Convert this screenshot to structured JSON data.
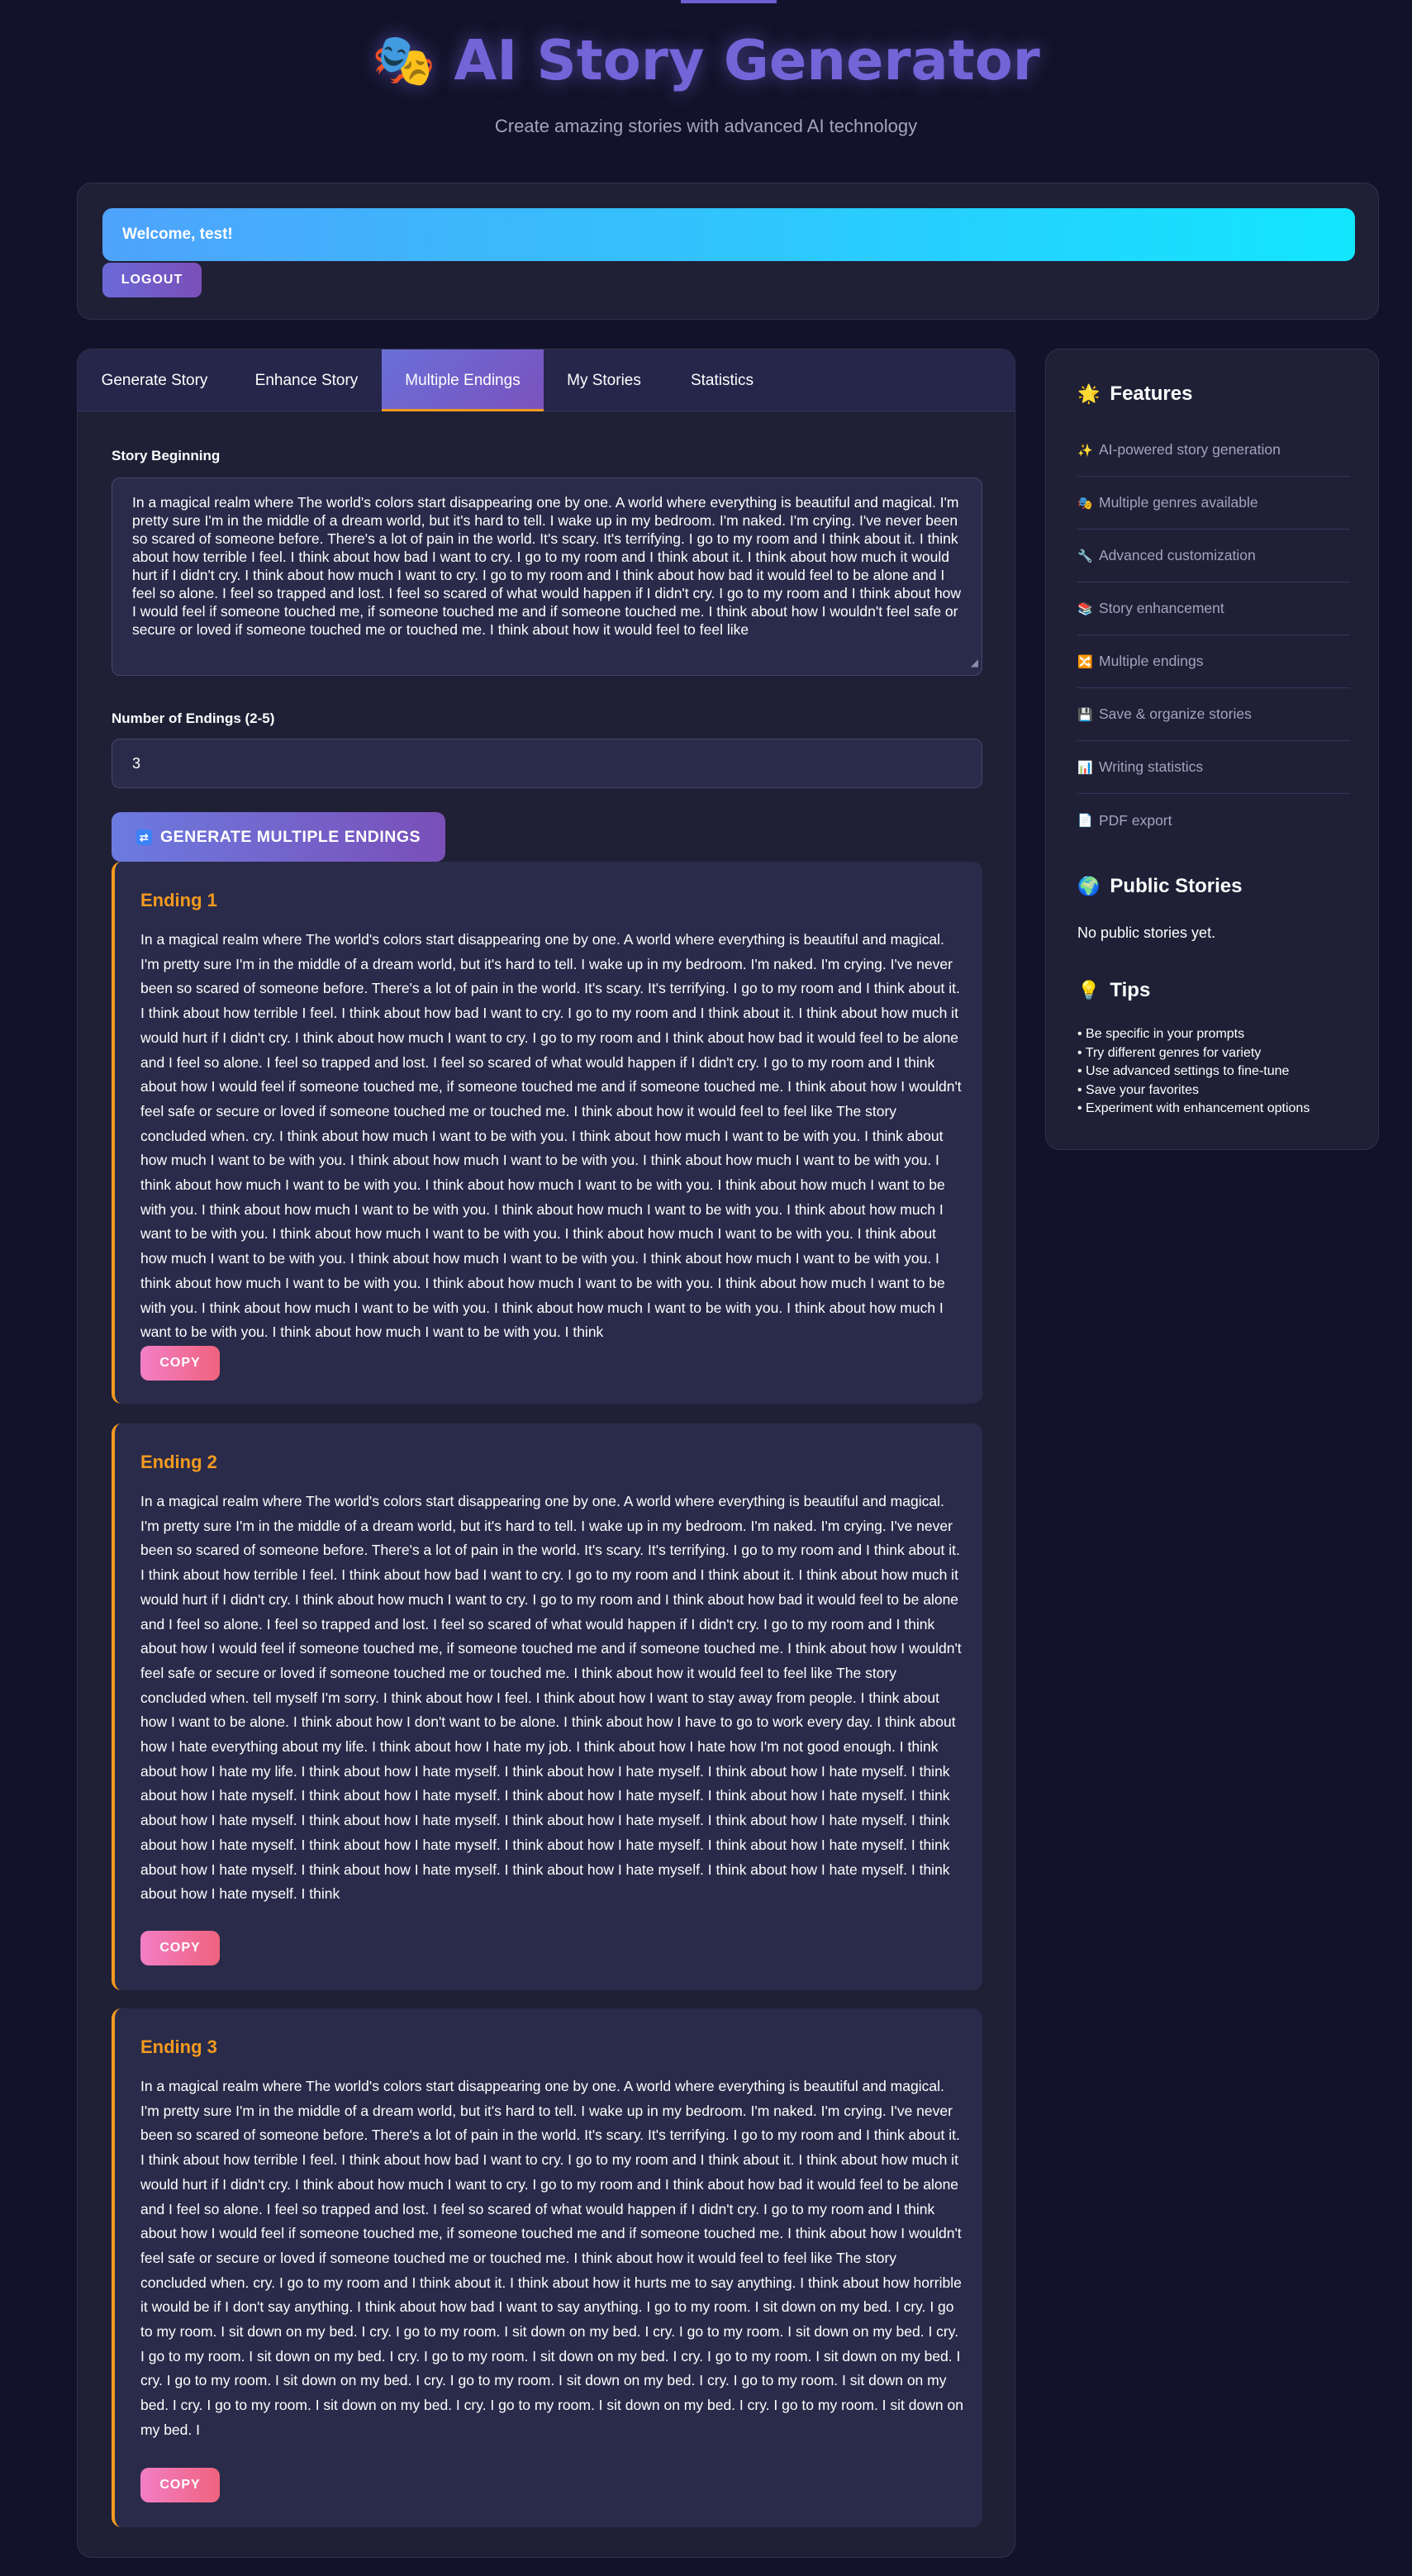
{
  "header": {
    "title": "AI Story Generator",
    "title_icon": "masks-icon",
    "subtitle": "Create amazing stories with advanced AI technology"
  },
  "user": {
    "welcome": "Welcome, test!",
    "logout_label": "LOGOUT"
  },
  "tabs": [
    {
      "label": "Generate Story",
      "active": false
    },
    {
      "label": "Enhance Story",
      "active": false
    },
    {
      "label": "Multiple Endings",
      "active": true
    },
    {
      "label": "My Stories",
      "active": false
    },
    {
      "label": "Statistics",
      "active": false
    }
  ],
  "form": {
    "story_label": "Story Beginning",
    "story_value": "In a magical realm where The world's colors start disappearing one by one. A world where everything is beautiful and magical. I'm pretty sure I'm in the middle of a dream world, but it's hard to tell. I wake up in my bedroom. I'm naked. I'm crying. I've never been so scared of someone before. There's a lot of pain in the world. It's scary. It's terrifying. I go to my room and I think about it. I think about how terrible I feel. I think about how bad I want to cry. I go to my room and I think about it. I think about how much it would hurt if I didn't cry. I think about how much I want to cry. I go to my room and I think about how bad it would feel to be alone and I feel so alone. I feel so trapped and lost. I feel so scared of what would happen if I didn't cry. I go to my room and I think about how I would feel if someone touched me, if someone touched me and if someone touched me. I think about how I wouldn't feel safe or secure or loved if someone touched me or touched me. I think about how it would feel to feel like",
    "endings_label": "Number of Endings (2-5)",
    "endings_value": "3",
    "generate_label": "GENERATE MULTIPLE ENDINGS",
    "generate_icon": "shuffle-icon"
  },
  "endings": [
    {
      "title": "Ending 1",
      "text": "In a magical realm where The world's colors start disappearing one by one. A world where everything is beautiful and magical. I'm pretty sure I'm in the middle of a dream world, but it's hard to tell. I wake up in my bedroom. I'm naked. I'm crying. I've never been so scared of someone before. There's a lot of pain in the world. It's scary. It's terrifying. I go to my room and I think about it. I think about how terrible I feel. I think about how bad I want to cry. I go to my room and I think about it. I think about how much it would hurt if I didn't cry. I think about how much I want to cry. I go to my room and I think about how bad it would feel to be alone and I feel so alone. I feel so trapped and lost. I feel so scared of what would happen if I didn't cry. I go to my room and I think about how I would feel if someone touched me, if someone touched me and if someone touched me. I think about how I wouldn't feel safe or secure or loved if someone touched me or touched me. I think about how it would feel to feel like The story concluded when. cry. I think about how much I want to be with you. I think about how much I want to be with you. I think about how much I want to be with you. I think about how much I want to be with you. I think about how much I want to be with you. I think about how much I want to be with you. I think about how much I want to be with you. I think about how much I want to be with you. I think about how much I want to be with you. I think about how much I want to be with you. I think about how much I want to be with you. I think about how much I want to be with you. I think about how much I want to be with you. I think about how much I want to be with you. I think about how much I want to be with you. I think about how much I want to be with you. I think about how much I want to be with you. I think about how much I want to be with you. I think about how much I want to be with you. I think about how much I want to be with you. I think about how much I want to be with you. I think about how much I want to be with you. I think about how much I want to be with you. I think",
      "copy_label": "COPY"
    },
    {
      "title": "Ending 2",
      "text": "In a magical realm where The world's colors start disappearing one by one. A world where everything is beautiful and magical. I'm pretty sure I'm in the middle of a dream world, but it's hard to tell. I wake up in my bedroom. I'm naked. I'm crying. I've never been so scared of someone before. There's a lot of pain in the world. It's scary. It's terrifying. I go to my room and I think about it. I think about how terrible I feel. I think about how bad I want to cry. I go to my room and I think about it. I think about how much it would hurt if I didn't cry. I think about how much I want to cry. I go to my room and I think about how bad it would feel to be alone and I feel so alone. I feel so trapped and lost. I feel so scared of what would happen if I didn't cry. I go to my room and I think about how I would feel if someone touched me, if someone touched me and if someone touched me. I think about how I wouldn't feel safe or secure or loved if someone touched me or touched me. I think about how it would feel to feel like The story concluded when. tell myself I'm sorry. I think about how I feel. I think about how I want to stay away from people. I think about how I want to be alone. I think about how I don't want to be alone. I think about how I have to go to work every day. I think about how I hate everything about my life. I think about how I hate my job. I think about how I hate how I'm not good enough. I think about how I hate my life. I think about how I hate myself. I think about how I hate myself. I think about how I hate myself. I think about how I hate myself. I think about how I hate myself. I think about how I hate myself. I think about how I hate myself. I think about how I hate myself. I think about how I hate myself. I think about how I hate myself. I think about how I hate myself. I think about how I hate myself. I think about how I hate myself. I think about how I hate myself. I think about how I hate myself. I think about how I hate myself. I think about how I hate myself. I think about how I hate myself. I think about how I hate myself. I think about how I hate myself. I think",
      "copy_label": "COPY"
    },
    {
      "title": "Ending 3",
      "text": "In a magical realm where The world's colors start disappearing one by one. A world where everything is beautiful and magical. I'm pretty sure I'm in the middle of a dream world, but it's hard to tell. I wake up in my bedroom. I'm naked. I'm crying. I've never been so scared of someone before. There's a lot of pain in the world. It's scary. It's terrifying. I go to my room and I think about it. I think about how terrible I feel. I think about how bad I want to cry. I go to my room and I think about it. I think about how much it would hurt if I didn't cry. I think about how much I want to cry. I go to my room and I think about how bad it would feel to be alone and I feel so alone. I feel so trapped and lost. I feel so scared of what would happen if I didn't cry. I go to my room and I think about how I would feel if someone touched me, if someone touched me and if someone touched me. I think about how I wouldn't feel safe or secure or loved if someone touched me or touched me. I think about how it would feel to feel like The story concluded when. cry. I go to my room and I think about it. I think about how it hurts me to say anything. I think about how horrible it would be if I don't say anything. I think about how bad I want to say anything. I go to my room. I sit down on my bed. I cry. I go to my room. I sit down on my bed. I cry. I go to my room. I sit down on my bed. I cry. I go to my room. I sit down on my bed. I cry. I go to my room. I sit down on my bed. I cry. I go to my room. I sit down on my bed. I cry. I go to my room. I sit down on my bed. I cry. I go to my room. I sit down on my bed. I cry. I go to my room. I sit down on my bed. I cry. I go to my room. I sit down on my bed. I cry. I go to my room. I sit down on my bed. I cry. I go to my room. I sit down on my bed. I cry. I go to my room. I sit down on my bed. I",
      "copy_label": "COPY"
    }
  ],
  "sidebar": {
    "features_heading": "Features",
    "features_icon": "sun-icon",
    "features": [
      {
        "icon": "sparkles-icon",
        "glyph": "✨",
        "label": "AI-powered story generation"
      },
      {
        "icon": "masks-icon",
        "glyph": "🎭",
        "label": "Multiple genres available"
      },
      {
        "icon": "wrench-icon",
        "glyph": "🔧",
        "label": "Advanced customization"
      },
      {
        "icon": "books-icon",
        "glyph": "📚",
        "label": "Story enhancement"
      },
      {
        "icon": "shuffle-icon",
        "glyph": "🔀",
        "label": "Multiple endings"
      },
      {
        "icon": "floppy-disk-icon",
        "glyph": "💾",
        "label": "Save & organize stories"
      },
      {
        "icon": "bar-chart-icon",
        "glyph": "📊",
        "label": "Writing statistics"
      },
      {
        "icon": "document-icon",
        "glyph": "📄",
        "label": "PDF export"
      }
    ],
    "public_heading": "Public Stories",
    "public_icon": "globe-icon",
    "public_empty": "No public stories yet.",
    "tips_heading": "Tips",
    "tips_icon": "lightbulb-icon",
    "tips": [
      "Be specific in your prompts",
      "Try different genres for variety",
      "Use advanced settings to fine-tune",
      "Save your favorites",
      "Experiment with enhancement options"
    ]
  }
}
